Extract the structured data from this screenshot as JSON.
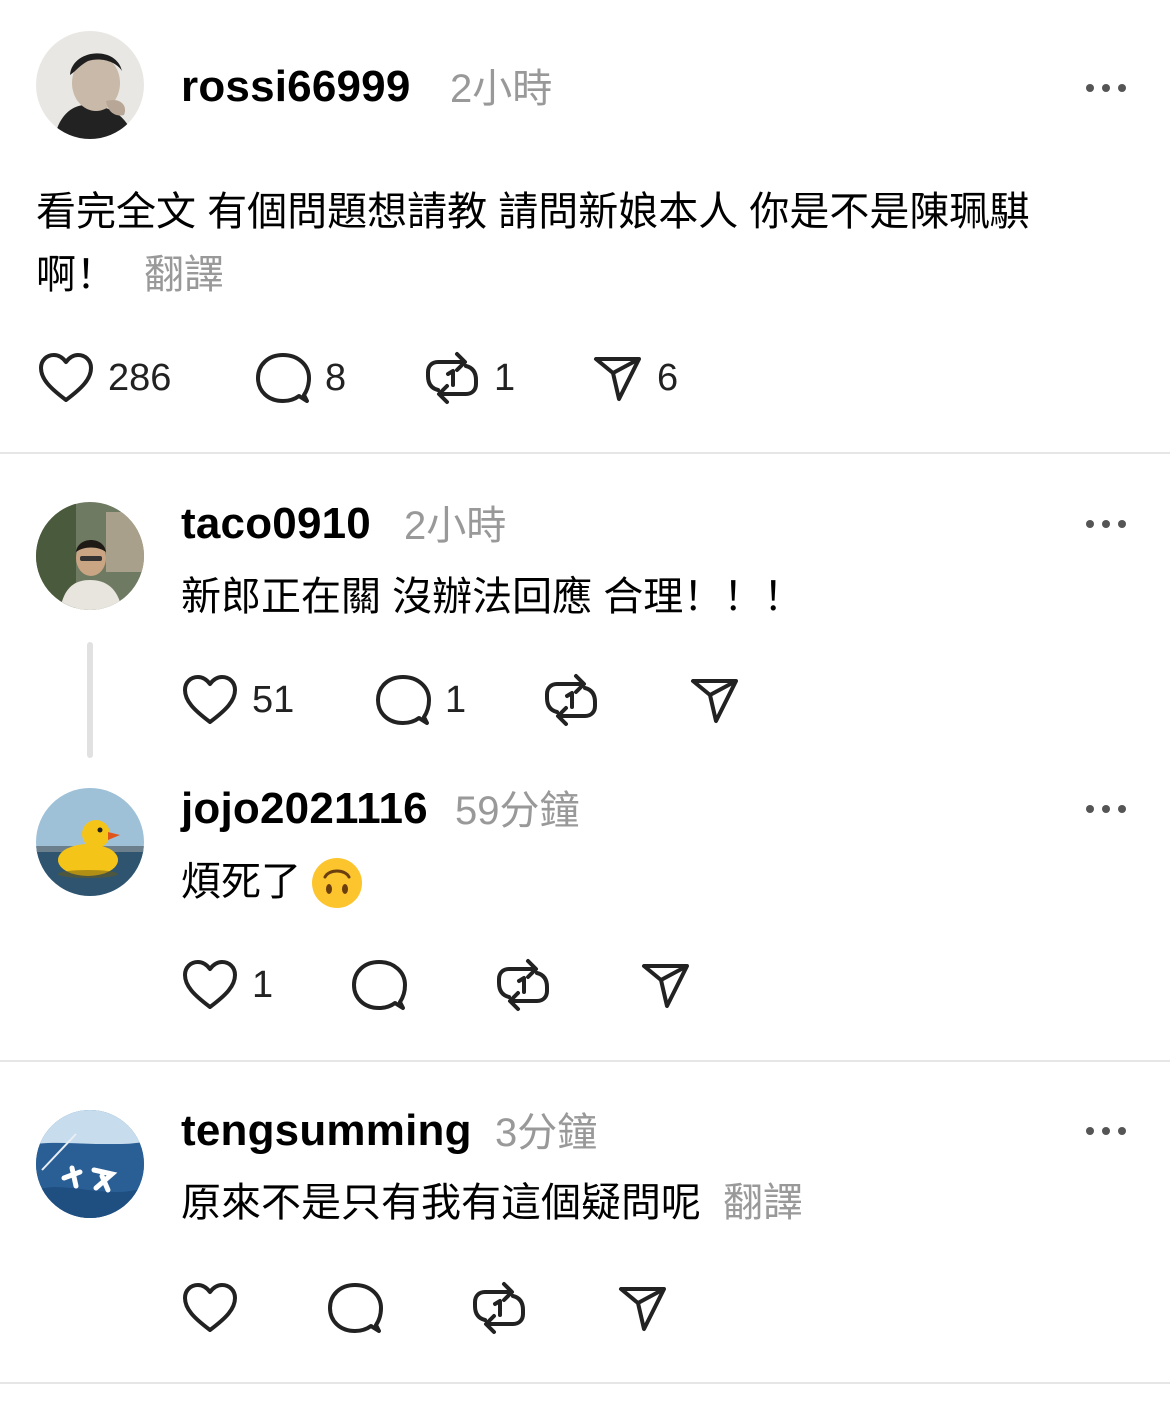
{
  "posts": [
    {
      "username": "rossi66999",
      "time": "2小時",
      "text_lines": [
        "看完全文 有個問題想請教 請問新娘本人 你是不是陳珮騏",
        "啊！"
      ],
      "translate": "翻譯",
      "likes": "286",
      "comments": "8",
      "reposts": "1",
      "shares": "6"
    },
    {
      "username": "taco0910",
      "time": "2小時",
      "text_lines": [
        "新郎正在關 沒辦法回應 合理！！！"
      ],
      "likes": "51",
      "comments": "1"
    },
    {
      "username": "jojo2021116",
      "time": "59分鐘",
      "text_lines": [
        "煩死了"
      ],
      "emoji": "upside-down-face",
      "likes": "1"
    },
    {
      "username": "tengsumming",
      "time": "3分鐘",
      "text_lines": [
        "原來不是只有我有這個疑問呢"
      ],
      "translate": "翻譯"
    }
  ],
  "icons": {
    "like": "heart-icon",
    "comment": "comment-bubble-icon",
    "repost": "repost-icon",
    "share": "send-icon",
    "more": "more-horizontal-icon"
  },
  "colors": {
    "text": "#000000",
    "muted": "#999999",
    "divider": "#e6e6e6"
  }
}
